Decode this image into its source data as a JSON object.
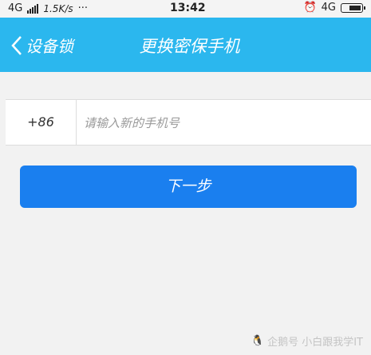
{
  "status_bar": {
    "network": "4G",
    "speed": "1.5K/s",
    "dots": "···",
    "time": "13:42",
    "network_right": "4G"
  },
  "header": {
    "back_label": "设备锁",
    "title": "更换密保手机"
  },
  "form": {
    "country_code": "+86",
    "phone_placeholder": "请输入新的手机号"
  },
  "actions": {
    "next_label": "下一步"
  },
  "watermark": {
    "text": "企鹅号 小白跟我学IT"
  },
  "colors": {
    "header": "#2bb7ee",
    "button": "#1a7fef"
  }
}
